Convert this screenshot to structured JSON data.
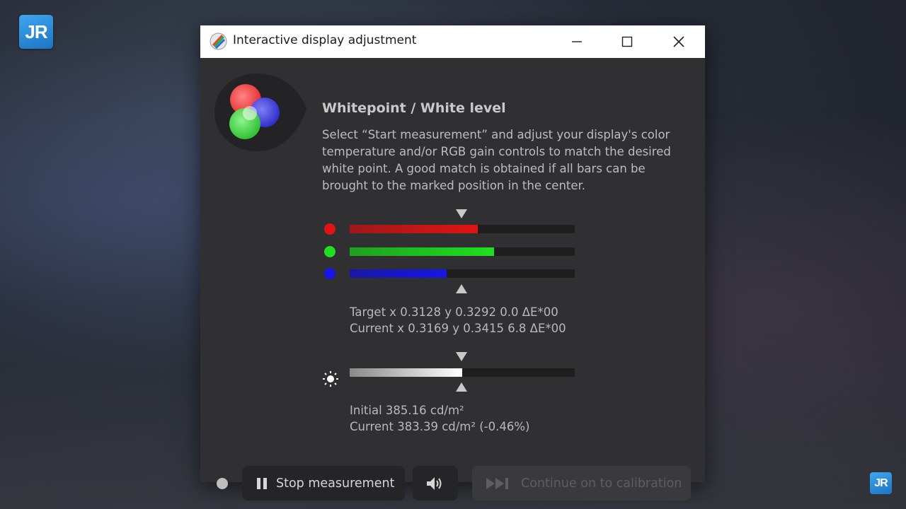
{
  "window": {
    "title": "Interactive display adjustment",
    "minimize_glyph": "—",
    "maximize_glyph": "☐",
    "close_glyph": "✕"
  },
  "watermark": {
    "logo_text": "JR"
  },
  "section": {
    "heading": "Whitepoint / White level",
    "description": "Select “Start measurement” and adjust your display's color temperature and/or RGB gain controls to match the desired white point. A good match is obtained if all bars can be brought to the marked position in the center."
  },
  "rgb_bars": [
    {
      "channel": "red",
      "color": "#e01414",
      "fill_fraction": 0.57
    },
    {
      "channel": "green",
      "color": "#1fe01f",
      "fill_fraction": 0.64
    },
    {
      "channel": "blue",
      "color": "#1616e6",
      "fill_fraction": 0.43
    }
  ],
  "whitepoint": {
    "target": "Target x 0.3128 y 0.3292 0.0 ΔE*00",
    "current": "Current x 0.3169 y 0.3415 6.8 ΔE*00"
  },
  "luminance": {
    "fill_fraction": 0.5,
    "initial": "Initial 385.16 cd/m²",
    "current": "Current 383.39 cd/m² (-0.46%)"
  },
  "buttons": {
    "stop": "Stop measurement",
    "continue": "Continue on to calibration"
  },
  "colors": {
    "window_bg": "#303032",
    "button_bg": "#252527",
    "track_bg": "#1e1e1f"
  }
}
